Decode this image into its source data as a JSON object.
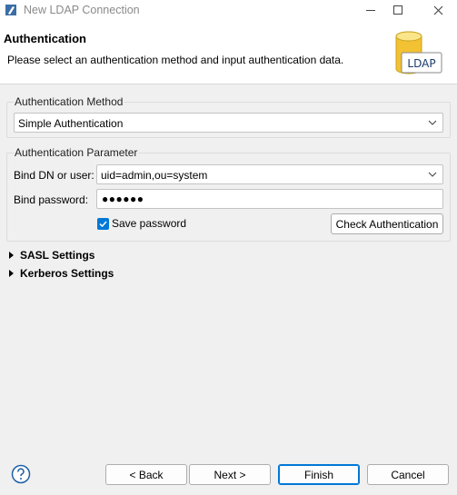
{
  "window": {
    "title": "New LDAP Connection"
  },
  "header": {
    "title": "Authentication",
    "description": "Please select an authentication method and input authentication data.",
    "logo_text": "LDAP"
  },
  "auth_method": {
    "legend": "Authentication Method",
    "selected": "Simple Authentication"
  },
  "auth_param": {
    "legend": "Authentication Parameter",
    "bind_dn_label": "Bind DN or user:",
    "bind_dn_value": "uid=admin,ou=system",
    "bind_password_label": "Bind password:",
    "bind_password_mask": "●●●●●●",
    "save_password_label": "Save password",
    "save_password_checked": true,
    "check_button": "Check Authentication"
  },
  "sections": {
    "sasl": "SASL Settings",
    "kerberos": "Kerberos Settings"
  },
  "footer": {
    "back": "< Back",
    "next": "Next >",
    "finish": "Finish",
    "cancel": "Cancel"
  },
  "colors": {
    "accent": "#0078d7",
    "logo_gold": "#f2c233"
  }
}
